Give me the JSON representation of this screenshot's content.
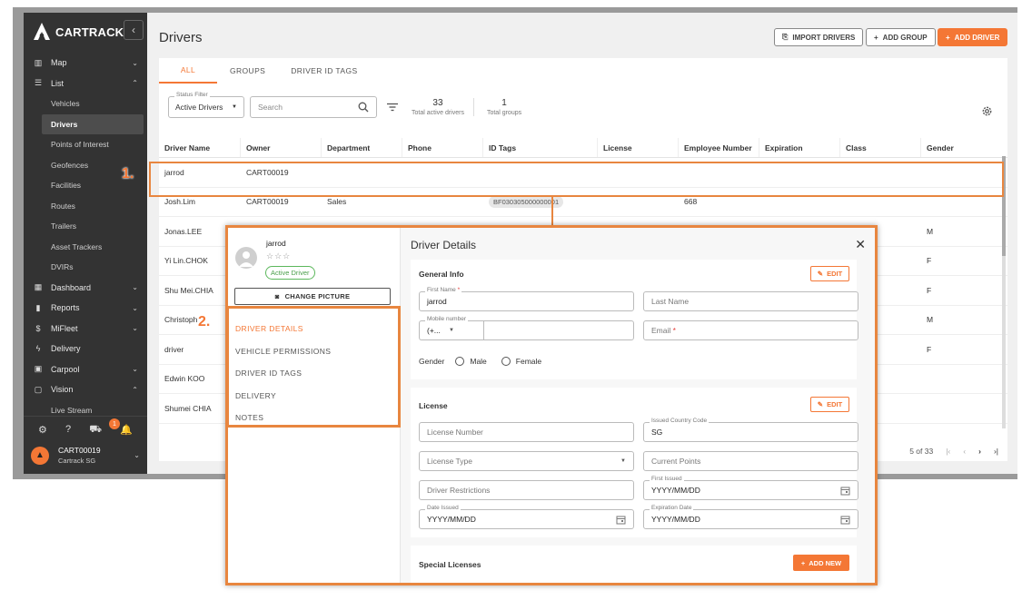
{
  "brand": {
    "name": "CARTRACK"
  },
  "sidebar": {
    "items": [
      {
        "label": "Map",
        "icon": "map-icon"
      },
      {
        "label": "List",
        "icon": "list-icon"
      }
    ],
    "list_sub": [
      "Vehicles",
      "Drivers",
      "Points of Interest",
      "Geofences",
      "Facilities",
      "Routes",
      "Trailers",
      "Asset Trackers",
      "DVIRs"
    ],
    "items2": [
      {
        "label": "Dashboard"
      },
      {
        "label": "Reports"
      },
      {
        "label": "MiFleet"
      },
      {
        "label": "Delivery"
      },
      {
        "label": "Carpool"
      },
      {
        "label": "Vision"
      }
    ],
    "vision_sub": [
      "Live Stream"
    ],
    "notification_count": "1",
    "account": {
      "name": "CART00019",
      "sub": "Cartrack SG"
    }
  },
  "header": {
    "title": "Drivers",
    "import_label": "IMPORT DRIVERS",
    "add_group_label": "ADD GROUP",
    "add_driver_label": "ADD DRIVER"
  },
  "tabs": [
    "ALL",
    "GROUPS",
    "DRIVER ID TAGS"
  ],
  "filters": {
    "status_label": "Status Filter",
    "status_value": "Active Drivers",
    "search_placeholder": "Search",
    "active_count": "33",
    "active_caption": "Total active drivers",
    "group_count": "1",
    "group_caption": "Total groups"
  },
  "table": {
    "columns": [
      "Driver Name",
      "Owner",
      "Department",
      "Phone",
      "ID Tags",
      "License",
      "Employee Number",
      "Expiration",
      "Class",
      "Gender"
    ],
    "rows": [
      {
        "name": "jarrod",
        "owner": "CART00019",
        "dept": "",
        "tag": "",
        "emp": "",
        "gender": ""
      },
      {
        "name": "Josh.Lim",
        "owner": "CART00019",
        "dept": "Sales",
        "tag": "BF030305000000001",
        "emp": "668",
        "gender": ""
      },
      {
        "name": "Jonas.LEE",
        "owner": "",
        "dept": "",
        "tag": "",
        "emp": "",
        "gender": "M"
      },
      {
        "name": "Yi Lin.CHOK",
        "owner": "",
        "dept": "",
        "tag": "",
        "emp": "",
        "gender": "F"
      },
      {
        "name": "Shu Mei.CHIA",
        "owner": "",
        "dept": "",
        "tag": "",
        "emp": "",
        "gender": "F"
      },
      {
        "name": "Christoph",
        "owner": "C",
        "dept": "",
        "tag": "",
        "emp": "",
        "gender": "M"
      },
      {
        "name": "driver",
        "owner": "",
        "dept": "",
        "tag": "",
        "emp": "",
        "gender": "F"
      },
      {
        "name": "Edwin KOO",
        "owner": "",
        "dept": "",
        "tag": "",
        "emp": "",
        "gender": ""
      },
      {
        "name": "Shumei CHIA",
        "owner": "",
        "dept": "",
        "tag": "",
        "emp": "",
        "gender": ""
      }
    ],
    "pager_text": "5 of 33"
  },
  "annotations": {
    "step1": "1.",
    "step2": "2."
  },
  "modal": {
    "name": "jarrod",
    "status": "Active Driver",
    "change_picture": "CHANGE PICTURE",
    "menu": [
      "DRIVER DETAILS",
      "VEHICLE PERMISSIONS",
      "DRIVER ID TAGS",
      "DELIVERY",
      "NOTES"
    ],
    "title": "Driver Details",
    "general": {
      "title": "General Info",
      "edit": "EDIT",
      "first_name_label": "First Name",
      "first_name": "jarrod",
      "last_name": "Last Name",
      "mobile_label": "Mobile number",
      "mobile_prefix": "(+...",
      "email": "Email",
      "gender_label": "Gender",
      "male": "Male",
      "female": "Female"
    },
    "license": {
      "title": "License",
      "edit": "EDIT",
      "license_number": "License Number",
      "country_label": "Issued Country Code",
      "country": "SG",
      "license_type": "License Type",
      "current_points": "Current Points",
      "restrictions": "Driver Restrictions",
      "first_issued_label": "First Issued",
      "first_issued": "YYYY/MM/DD",
      "date_issued_label": "Date Issued",
      "date_issued": "YYYY/MM/DD",
      "expiration_label": "Expiration Date",
      "expiration": "YYYY/MM/DD"
    },
    "special": {
      "title": "Special Licenses",
      "add_new": "ADD NEW"
    }
  },
  "colors": {
    "accent": "#f47735",
    "sidebar": "#333333"
  }
}
